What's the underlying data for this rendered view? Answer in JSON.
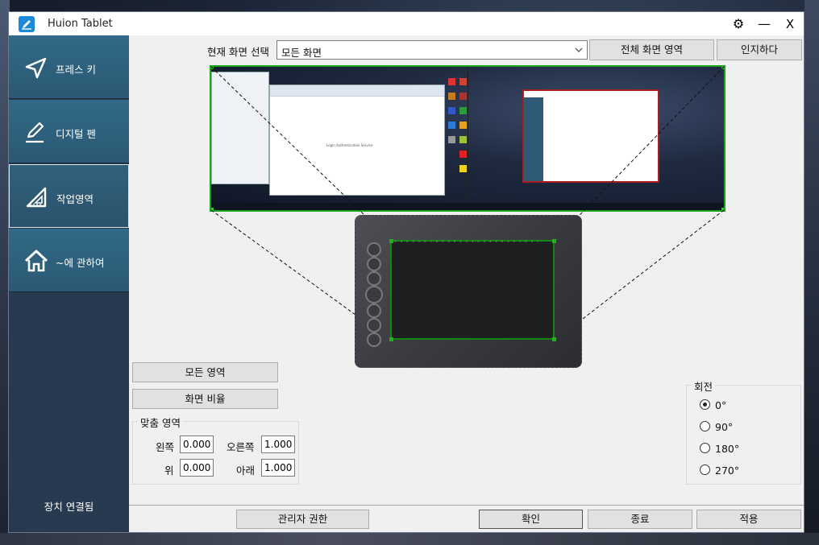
{
  "window": {
    "title": "Huion Tablet",
    "gear": "⚙",
    "minimize": "—",
    "close": "X"
  },
  "sidebar": {
    "items": [
      {
        "label": "프레스 키",
        "icon": "send-icon"
      },
      {
        "label": "디지털 펜",
        "icon": "pen-icon"
      },
      {
        "label": "작업영역",
        "icon": "triangle-ruler-icon"
      },
      {
        "label": "~에 관하여",
        "icon": "home-icon"
      }
    ],
    "active_index": 2,
    "status": "장치 연결됨"
  },
  "screen": {
    "label": "현재 화면 선택",
    "selected": "모든 화면",
    "full_screen_button": "전체 화면 영역",
    "identify_button": "인지하다"
  },
  "area": {
    "all_area_button": "모든 영역",
    "ratio_button": "화면 비율",
    "custom_title": "맞춤 영역",
    "left_label": "왼쪽",
    "left_value": "0.000",
    "right_label": "오른쪽",
    "right_value": "1.000",
    "top_label": "위",
    "top_value": "0.000",
    "bottom_label": "아래",
    "bottom_value": "1.000"
  },
  "rotation": {
    "title": "회전",
    "options": [
      "0°",
      "90°",
      "180°",
      "270°"
    ],
    "selected_index": 0
  },
  "footer": {
    "admin_button": "관리자 권한",
    "ok_button": "확인",
    "exit_button": "종료",
    "apply_button": "적용"
  },
  "colors": {
    "sidebar_bg": "#273a4f",
    "nav_item_bg": "#306a86",
    "preview_border": "#1aa51a",
    "title_icon": "#1e88d8"
  },
  "preview": {
    "window_text": "Login Authentication Service"
  }
}
